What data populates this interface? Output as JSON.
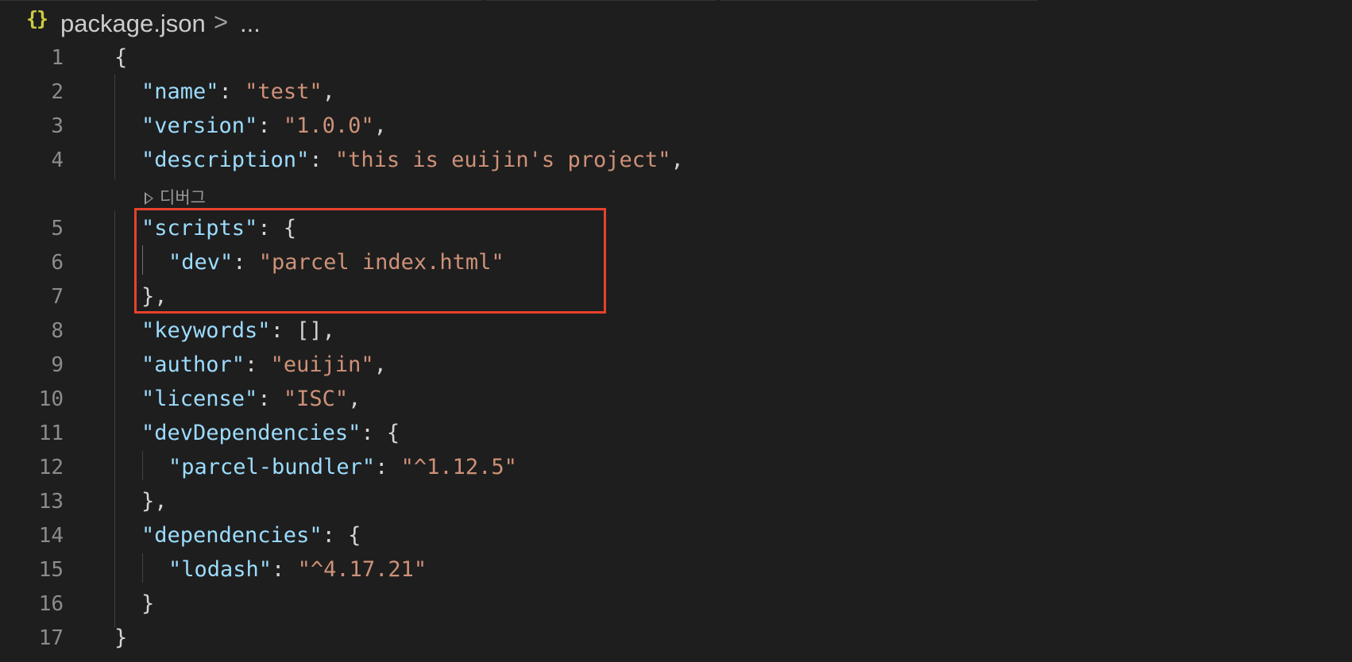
{
  "breadcrumb": {
    "icon": "{}",
    "icon_name": "json-braces-icon",
    "file": "package.json",
    "separator": ">",
    "more": "..."
  },
  "codelens": {
    "label": "디버그"
  },
  "colors": {
    "background": "#1e1e1e",
    "key": "#9cdcfe",
    "string": "#ce9178",
    "punctuation": "#d4d4d4",
    "line_number": "#8c8c8c",
    "highlight_box": "#e8412c"
  },
  "lines": [
    {
      "n": "1",
      "tokens": [
        {
          "t": "p",
          "v": "{"
        }
      ]
    },
    {
      "n": "2",
      "tokens": [
        {
          "t": "k",
          "v": "\"name\""
        },
        {
          "t": "p",
          "v": ": "
        },
        {
          "t": "s",
          "v": "\"test\""
        },
        {
          "t": "p",
          "v": ","
        }
      ]
    },
    {
      "n": "3",
      "tokens": [
        {
          "t": "k",
          "v": "\"version\""
        },
        {
          "t": "p",
          "v": ": "
        },
        {
          "t": "s",
          "v": "\"1.0.0\""
        },
        {
          "t": "p",
          "v": ","
        }
      ]
    },
    {
      "n": "4",
      "tokens": [
        {
          "t": "k",
          "v": "\"description\""
        },
        {
          "t": "p",
          "v": ": "
        },
        {
          "t": "s",
          "v": "\"this is euijin's project\""
        },
        {
          "t": "p",
          "v": ","
        }
      ]
    },
    {
      "n": "5",
      "tokens": [
        {
          "t": "k",
          "v": "\"scripts\""
        },
        {
          "t": "p",
          "v": ": {"
        }
      ]
    },
    {
      "n": "6",
      "tokens": [
        {
          "t": "k",
          "v": "\"dev\""
        },
        {
          "t": "p",
          "v": ": "
        },
        {
          "t": "s",
          "v": "\"parcel index.html\""
        }
      ]
    },
    {
      "n": "7",
      "tokens": [
        {
          "t": "p",
          "v": "},"
        }
      ]
    },
    {
      "n": "8",
      "tokens": [
        {
          "t": "k",
          "v": "\"keywords\""
        },
        {
          "t": "p",
          "v": ": [],"
        }
      ]
    },
    {
      "n": "9",
      "tokens": [
        {
          "t": "k",
          "v": "\"author\""
        },
        {
          "t": "p",
          "v": ": "
        },
        {
          "t": "s",
          "v": "\"euijin\""
        },
        {
          "t": "p",
          "v": ","
        }
      ]
    },
    {
      "n": "10",
      "tokens": [
        {
          "t": "k",
          "v": "\"license\""
        },
        {
          "t": "p",
          "v": ": "
        },
        {
          "t": "s",
          "v": "\"ISC\""
        },
        {
          "t": "p",
          "v": ","
        }
      ]
    },
    {
      "n": "11",
      "tokens": [
        {
          "t": "k",
          "v": "\"devDependencies\""
        },
        {
          "t": "p",
          "v": ": {"
        }
      ]
    },
    {
      "n": "12",
      "tokens": [
        {
          "t": "k",
          "v": "\"parcel-bundler\""
        },
        {
          "t": "p",
          "v": ": "
        },
        {
          "t": "s",
          "v": "\"^1.12.5\""
        }
      ]
    },
    {
      "n": "13",
      "tokens": [
        {
          "t": "p",
          "v": "},"
        }
      ]
    },
    {
      "n": "14",
      "tokens": [
        {
          "t": "k",
          "v": "\"dependencies\""
        },
        {
          "t": "p",
          "v": ": {"
        }
      ]
    },
    {
      "n": "15",
      "tokens": [
        {
          "t": "k",
          "v": "\"lodash\""
        },
        {
          "t": "p",
          "v": ": "
        },
        {
          "t": "s",
          "v": "\"^4.17.21\""
        }
      ]
    },
    {
      "n": "16",
      "tokens": [
        {
          "t": "p",
          "v": "}"
        }
      ]
    },
    {
      "n": "17",
      "tokens": [
        {
          "t": "p",
          "v": "}"
        }
      ]
    }
  ]
}
